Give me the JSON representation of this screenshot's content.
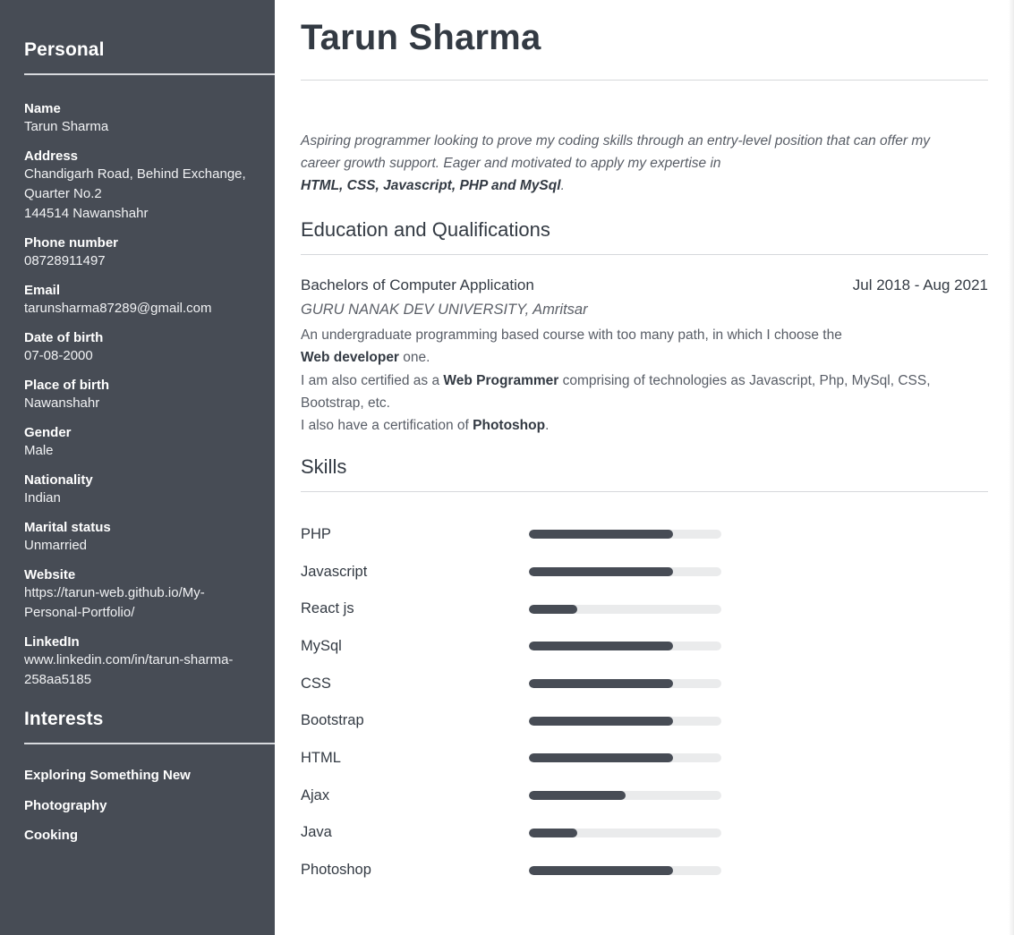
{
  "sidebar": {
    "personal_title": "Personal",
    "fields": [
      {
        "label": "Name",
        "value": "Tarun Sharma"
      },
      {
        "label": "Address",
        "value": [
          "Chandigarh Road, Behind Exchange,",
          "Quarter No.2",
          "144514 Nawanshahr"
        ]
      },
      {
        "label": "Phone number",
        "value": "08728911497"
      },
      {
        "label": "Email",
        "value": "tarunsharma87289@gmail.com"
      },
      {
        "label": "Date of birth",
        "value": "07-08-2000"
      },
      {
        "label": "Place of birth",
        "value": "Nawanshahr"
      },
      {
        "label": "Gender",
        "value": "Male"
      },
      {
        "label": "Nationality",
        "value": "Indian"
      },
      {
        "label": "Marital status",
        "value": "Unmarried"
      },
      {
        "label": "Website",
        "value": [
          "https://tarun-web.github.io/My-",
          "Personal-Portfolio/"
        ]
      },
      {
        "label": "LinkedIn",
        "value": [
          "www.linkedin.com/in/tarun-sharma-",
          "258aa5185"
        ]
      }
    ],
    "interests_title": "Interests",
    "interests": [
      "Exploring Something New",
      "Photography",
      "Cooking"
    ]
  },
  "main": {
    "name": "Tarun Sharma",
    "summary": {
      "line1": "Aspiring programmer looking to prove my coding skills through an entry-level position that can offer my",
      "line2": "career growth support. Eager and motivated to apply my expertise in",
      "skills_bold": "HTML, CSS, Javascript, PHP and MySql",
      "end": "."
    },
    "education_title": "Education and Qualifications",
    "education": {
      "degree": "Bachelors of Computer Application",
      "dates": "Jul 2018 - Aug 2021",
      "school": "GURU NANAK DEV UNIVERSITY, Amritsar",
      "desc1": "An undergraduate programming based course with too many path, in which I choose the",
      "desc1_bold": "Web developer",
      "desc1_end": " one.",
      "desc2_start": "I am also certified as a ",
      "desc2_bold": "Web Programmer",
      "desc2_end": " comprising of technologies as Javascript, Php, MySql, CSS,",
      "desc2_line2": "Bootstrap, etc.",
      "desc3_start": "I also have a certification of ",
      "desc3_bold": "Photoshop",
      "desc3_end": "."
    },
    "skills_title": "Skills",
    "skills": [
      {
        "name": "PHP",
        "level": 0.75
      },
      {
        "name": "Javascript",
        "level": 0.75
      },
      {
        "name": "React js",
        "level": 0.25
      },
      {
        "name": "MySql",
        "level": 0.75
      },
      {
        "name": "CSS",
        "level": 0.75
      },
      {
        "name": "Bootstrap",
        "level": 0.75
      },
      {
        "name": "HTML",
        "level": 0.75
      },
      {
        "name": "Ajax",
        "level": 0.5
      },
      {
        "name": "Java",
        "level": 0.25
      },
      {
        "name": "Photoshop",
        "level": 0.75
      }
    ]
  }
}
